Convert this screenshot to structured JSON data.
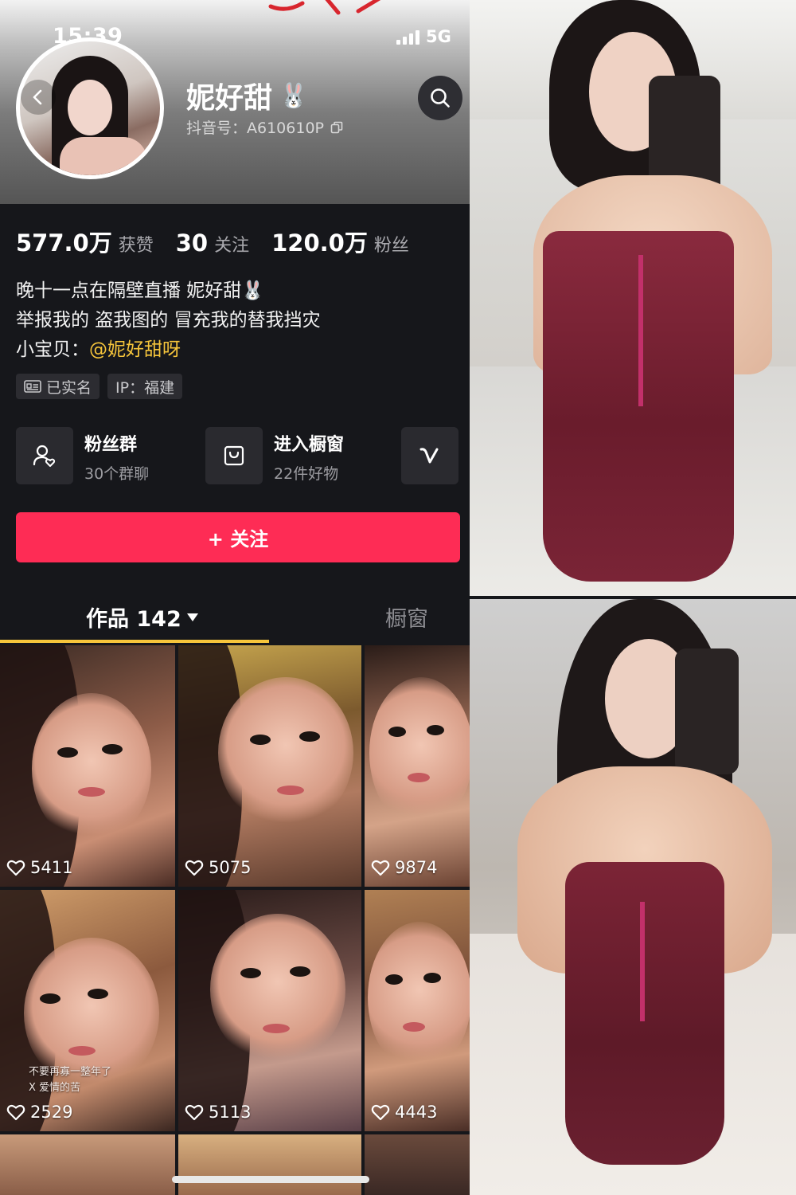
{
  "status_bar": {
    "time": "15:39",
    "network": "5G"
  },
  "profile": {
    "name": "妮好甜",
    "name_emoji": "🐰",
    "account_id": "抖音号：A610610P",
    "stats": [
      {
        "value": "577.0万",
        "label": "获赞"
      },
      {
        "value": "30",
        "label": "关注"
      },
      {
        "value": "120.0万",
        "label": "粉丝"
      }
    ],
    "bio": {
      "line1": "晚十一点在隔壁直播  妮好甜🐰",
      "line2": "举报我的 盗我图的 冒充我的替我挡灾",
      "line3_prefix": "小宝贝：",
      "line3_mention": "@妮好甜呀"
    },
    "tags": [
      {
        "label": "已实名",
        "icon": "id-card-icon"
      },
      {
        "label": "IP：福建"
      }
    ]
  },
  "cards": {
    "fan_group": {
      "title": "粉丝群",
      "subtitle": "30个群聊",
      "icon": "user-heart-icon"
    },
    "showcase": {
      "title": "进入橱窗",
      "subtitle": "22件好物",
      "icon": "shopping-bag-icon"
    },
    "extra_icon": "v-icon"
  },
  "follow_button": {
    "label": "+ 关注"
  },
  "tabs": {
    "works": "作品 142",
    "showcase": "橱窗"
  },
  "videos": [
    {
      "likes": "5411"
    },
    {
      "likes": "5075"
    },
    {
      "likes": "9874"
    },
    {
      "likes": "2529",
      "caption_line1": "不要再寡一整年了",
      "caption_line2": "X       爱情的苦"
    },
    {
      "likes": "5113"
    },
    {
      "likes": "4443"
    }
  ],
  "colors": {
    "accent": "#fe2c55",
    "mention": "#f6c53b",
    "background": "#16171b"
  }
}
